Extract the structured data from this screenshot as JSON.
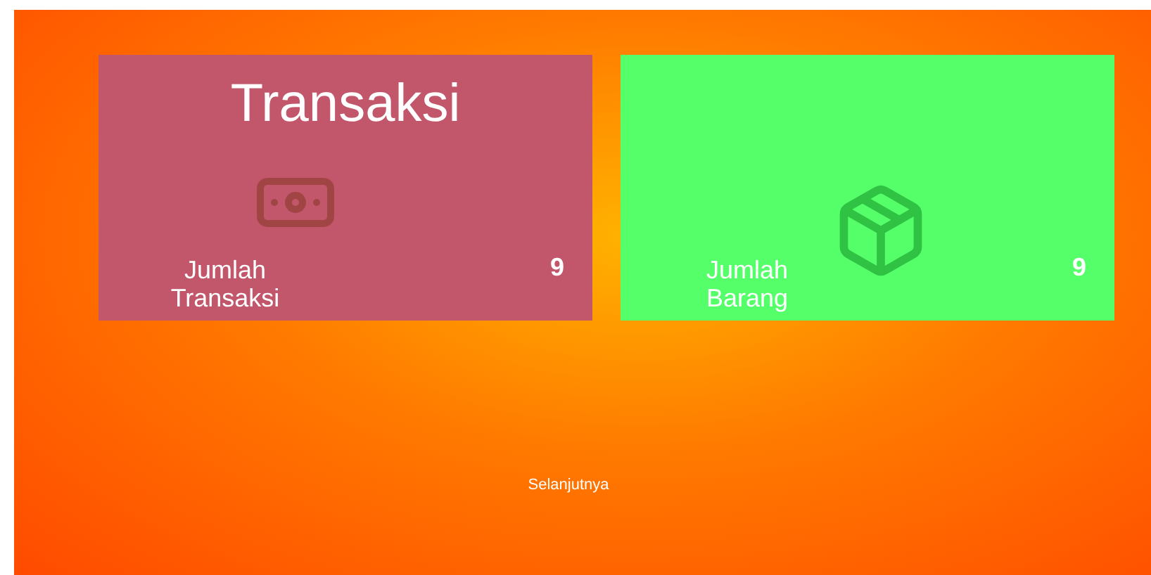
{
  "cards": [
    {
      "kind": "transaction",
      "title": "Transaksi",
      "label": "Jumlah Transaksi",
      "count": "9",
      "color": "#c2566b"
    },
    {
      "kind": "goods",
      "label": "Jumlah Barang",
      "count": "9",
      "color": "#55ff6a"
    }
  ],
  "footer": {
    "link": "Selanjutnya"
  }
}
